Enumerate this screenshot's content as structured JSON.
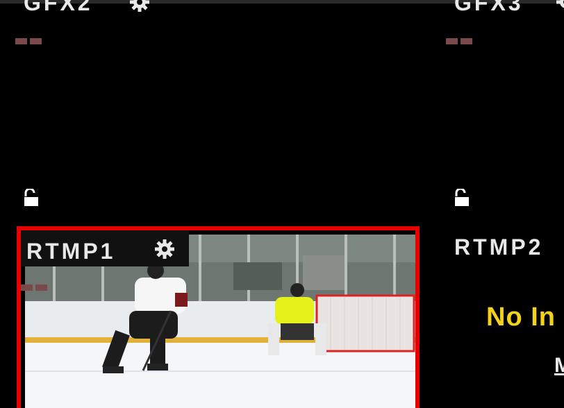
{
  "tiles": {
    "gfx2": {
      "label": "GFX2"
    },
    "gfx3": {
      "label": "GFX3"
    },
    "rtmp1": {
      "label": "RTMP1",
      "active": true
    },
    "rtmp2": {
      "label": "RTMP2",
      "status": "No In",
      "link": "M"
    }
  },
  "icons": {
    "settings": "gear-icon",
    "lock": "unlocked-padlock-icon"
  },
  "colors": {
    "active_border": "#e60000",
    "no_input_text": "#f2d21a",
    "meter": "#7a4a4a"
  }
}
